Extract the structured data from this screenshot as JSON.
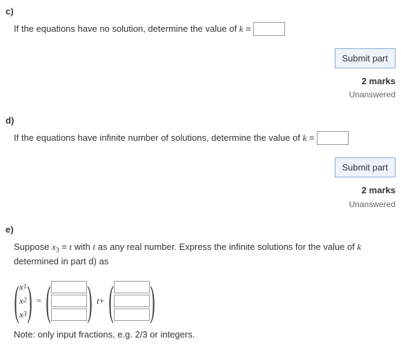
{
  "part_c": {
    "label": "c)",
    "text_before": "If the equations have no solution, determine the value of ",
    "var": "k",
    "equals": " =",
    "input_value": "",
    "submit_label": "Submit part",
    "marks": "2 marks",
    "status": "Unanswered"
  },
  "part_d": {
    "label": "d)",
    "text_before": "If the equations have infinite number of solutions, determine the value of ",
    "var": "k",
    "equals": " =",
    "input_value": "",
    "submit_label": "Submit part",
    "marks": "2 marks",
    "status": "Unanswered"
  },
  "part_e": {
    "label": "e)",
    "text_a": "Suppose ",
    "x3": "x",
    "x3_sub": "3",
    "eq_t": " = ",
    "t_var": "t",
    "text_b": " with ",
    "text_c": " as any real number. Express the infinite solutions for the value of ",
    "k_var": "k",
    "text_d": " determined in part d) as",
    "lhs": {
      "r1": "x",
      "r1_sub": "1",
      "r2": "x",
      "r2_sub": "2",
      "r3": "x",
      "r3_sub": "3"
    },
    "equals": "=",
    "vec1": {
      "r1": "",
      "r2": "",
      "r3": ""
    },
    "t_label": "t",
    "plus": "+",
    "vec2": {
      "r1": "",
      "r2": "",
      "r3": ""
    },
    "note": "Note: only input fractions, e.g. 2/3 or integers."
  }
}
